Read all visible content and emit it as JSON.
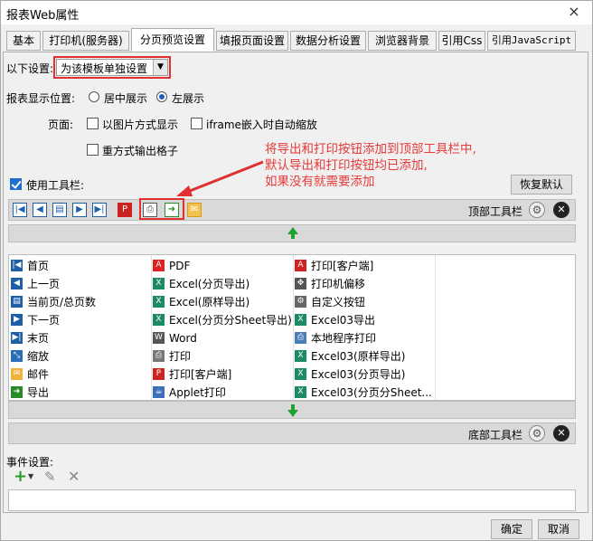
{
  "window": {
    "title": "报表Web属性",
    "close_icon": "×"
  },
  "tabs": [
    {
      "label": "基本"
    },
    {
      "label": "打印机(服务器)"
    },
    {
      "label": "分页预览设置"
    },
    {
      "label": "填报页面设置"
    },
    {
      "label": "数据分析设置"
    },
    {
      "label": "浏览器背景"
    },
    {
      "label": "引用Css"
    },
    {
      "label": "引用JavaScript"
    }
  ],
  "settings": {
    "label": "以下设置:",
    "value": "为该模板单独设置"
  },
  "display": {
    "label": "报表显示位置:",
    "center": "居中展示",
    "left": "左展示",
    "selected": "left"
  },
  "page": {
    "label": "页面:",
    "as_image": "以图片方式显示",
    "iframe_zoom": "iframe嵌入时自动缩放",
    "repeat_cells": "重方式输出格子"
  },
  "toolbar": {
    "use_label": "使用工具栏:",
    "restore": "恢复默认",
    "top_label": "顶部工具栏",
    "bottom_label": "底部工具栏"
  },
  "annotation": [
    "将导出和打印按钮添加到顶部工具栏中,",
    "默认导出和打印按钮均已添加,",
    "如果没有就需要添加"
  ],
  "buttons": {
    "col1": [
      {
        "label": "首页",
        "icon": "first-page-icon"
      },
      {
        "label": "上一页",
        "icon": "prev-page-icon"
      },
      {
        "label": "当前页/总页数",
        "icon": "page-count-icon"
      },
      {
        "label": "下一页",
        "icon": "next-page-icon"
      },
      {
        "label": "末页",
        "icon": "last-page-icon"
      },
      {
        "label": "缩放",
        "icon": "zoom-icon"
      },
      {
        "label": "邮件",
        "icon": "mail-icon"
      },
      {
        "label": "导出",
        "icon": "export-icon"
      }
    ],
    "col2": [
      {
        "label": "PDF",
        "icon": "pdf-icon"
      },
      {
        "label": "Excel(分页导出)",
        "icon": "excel-icon"
      },
      {
        "label": "Excel(原样导出)",
        "icon": "excel-icon"
      },
      {
        "label": "Excel(分页分Sheet导出)",
        "icon": "excel-icon"
      },
      {
        "label": "Word",
        "icon": "word-icon"
      },
      {
        "label": "打印",
        "icon": "print-icon"
      },
      {
        "label": "打印[客户端]",
        "icon": "print-client-icon"
      },
      {
        "label": "Applet打印",
        "icon": "applet-icon"
      }
    ],
    "col3": [
      {
        "label": "打印[客户端]",
        "icon": "pdf-print-icon"
      },
      {
        "label": "打印机偏移",
        "icon": "move-icon"
      },
      {
        "label": "自定义按钮",
        "icon": "custom-icon"
      },
      {
        "label": "Excel03导出",
        "icon": "excel-icon"
      },
      {
        "label": "本地程序打印",
        "icon": "local-print-icon"
      },
      {
        "label": "Excel03(原样导出)",
        "icon": "excel-icon"
      },
      {
        "label": "Excel03(分页导出)",
        "icon": "excel-icon"
      },
      {
        "label": "Excel03(分页分Sheet...",
        "icon": "excel-icon"
      }
    ]
  },
  "events": {
    "label": "事件设置:"
  },
  "footer": {
    "ok": "确定",
    "cancel": "取消"
  }
}
